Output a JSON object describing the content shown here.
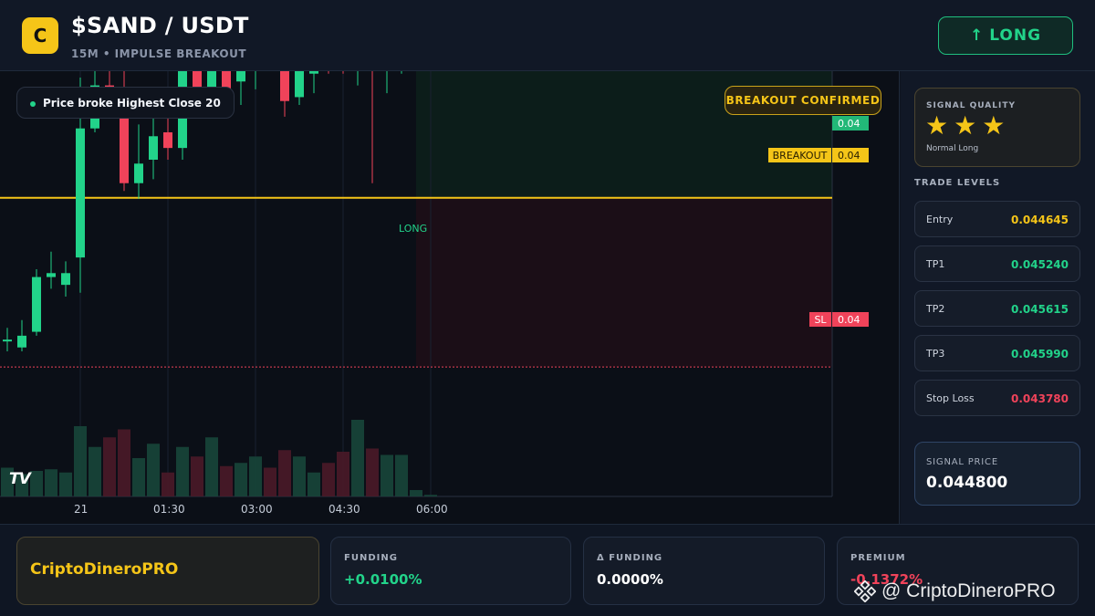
{
  "header": {
    "logo_letter": "C",
    "pair": "$SAND / USDT",
    "subtitle": "15M • IMPULSE BREAKOUT",
    "direction_arrow": "↑",
    "direction_label": "LONG",
    "accent": "#22d38a"
  },
  "chart": {
    "info_pill": "Price broke Highest Close 20",
    "confirmed_badge": "BREAKOUT CONFIRMED",
    "current_price_tag": "0.04",
    "breakout_label": "BREAKOUT",
    "breakout_value": "0.04",
    "sl_label": "SL",
    "sl_value": "0.04",
    "entry_marker_label": "LONG",
    "tv_logo": "TV",
    "x_ticks": [
      "21",
      "01:30",
      "03:00",
      "04:30",
      "06:00"
    ],
    "colors": {
      "up": "#22d38a",
      "down": "#f0435a",
      "breakout": "#f5c518"
    }
  },
  "chart_data": {
    "type": "candlestick",
    "y_axis_labels_shown": [
      "0.04"
    ],
    "price_scale": {
      "low": 0.04365,
      "high": 0.04505
    },
    "breakout_level": 0.044645,
    "stop_loss": 0.04378,
    "candles": [
      {
        "o": 0.04392,
        "h": 0.04398,
        "l": 0.04386,
        "c": 0.04392
      },
      {
        "o": 0.04388,
        "h": 0.04402,
        "l": 0.04386,
        "c": 0.04394
      },
      {
        "o": 0.04396,
        "h": 0.04428,
        "l": 0.04394,
        "c": 0.04424
      },
      {
        "o": 0.04424,
        "h": 0.04437,
        "l": 0.04418,
        "c": 0.04426
      },
      {
        "o": 0.0442,
        "h": 0.04432,
        "l": 0.04414,
        "c": 0.04426
      },
      {
        "o": 0.04434,
        "h": 0.04526,
        "l": 0.04416,
        "c": 0.045
      },
      {
        "o": 0.045,
        "h": 0.04542,
        "l": 0.04498,
        "c": 0.04522
      },
      {
        "o": 0.04522,
        "h": 0.0455,
        "l": 0.04514,
        "c": 0.04514
      },
      {
        "o": 0.04512,
        "h": 0.04556,
        "l": 0.04468,
        "c": 0.04472
      },
      {
        "o": 0.04472,
        "h": 0.04502,
        "l": 0.04464,
        "c": 0.04482
      },
      {
        "o": 0.04484,
        "h": 0.04516,
        "l": 0.04474,
        "c": 0.04496
      },
      {
        "o": 0.04498,
        "h": 0.04514,
        "l": 0.04484,
        "c": 0.0449
      },
      {
        "o": 0.0449,
        "h": 0.0455,
        "l": 0.04484,
        "c": 0.04536
      },
      {
        "o": 0.04534,
        "h": 0.0454,
        "l": 0.04514,
        "c": 0.04518
      },
      {
        "o": 0.04518,
        "h": 0.04542,
        "l": 0.04508,
        "c": 0.0454
      },
      {
        "o": 0.04538,
        "h": 0.04544,
        "l": 0.0452,
        "c": 0.0452
      },
      {
        "o": 0.04524,
        "h": 0.04536,
        "l": 0.04512,
        "c": 0.04532
      },
      {
        "o": 0.0453,
        "h": 0.0456,
        "l": 0.0452,
        "c": 0.0455
      },
      {
        "o": 0.04546,
        "h": 0.04556,
        "l": 0.04534,
        "c": 0.04536
      },
      {
        "o": 0.04542,
        "h": 0.04552,
        "l": 0.04506,
        "c": 0.04514
      },
      {
        "o": 0.04516,
        "h": 0.04546,
        "l": 0.04512,
        "c": 0.0453
      },
      {
        "o": 0.04528,
        "h": 0.04554,
        "l": 0.04518,
        "c": 0.04544
      },
      {
        "o": 0.04542,
        "h": 0.04546,
        "l": 0.04528,
        "c": 0.04538
      },
      {
        "o": 0.04538,
        "h": 0.0455,
        "l": 0.04528,
        "c": 0.04534
      },
      {
        "o": 0.04532,
        "h": 0.04544,
        "l": 0.04522,
        "c": 0.04544
      },
      {
        "o": 0.04544,
        "h": 0.0455,
        "l": 0.04472,
        "c": 0.04538
      },
      {
        "o": 0.0453,
        "h": 0.0454,
        "l": 0.04518,
        "c": 0.04534
      },
      {
        "o": 0.04534,
        "h": 0.04564,
        "l": 0.04528,
        "c": 0.0456
      },
      {
        "o": 0.0456,
        "h": 0.0461,
        "l": 0.04554,
        "c": 0.04602
      },
      {
        "o": 0.04602,
        "h": 0.04604,
        "l": 0.04602,
        "c": 0.04603
      }
    ],
    "volumes": [
      18,
      14,
      16,
      17,
      15,
      44,
      31,
      37,
      42,
      24,
      33,
      15,
      31,
      25,
      37,
      19,
      21,
      25,
      18,
      29,
      25,
      15,
      21,
      28,
      48,
      30,
      26,
      26,
      4,
      1
    ]
  },
  "panel": {
    "quality_title": "SIGNAL QUALITY",
    "stars": [
      "★",
      "★",
      "★"
    ],
    "quality_sub": "Normal Long",
    "levels_title": "TRADE LEVELS",
    "levels": [
      {
        "label": "Entry",
        "value": "0.044645",
        "color": "#f5c518"
      },
      {
        "label": "TP1",
        "value": "0.045240",
        "color": "#22d38a"
      },
      {
        "label": "TP2",
        "value": "0.045615",
        "color": "#22d38a"
      },
      {
        "label": "TP3",
        "value": "0.045990",
        "color": "#22d38a"
      },
      {
        "label": "Stop Loss",
        "value": "0.043780",
        "color": "#f0435a"
      }
    ],
    "signal_title": "SIGNAL PRICE",
    "signal_value": "0.044800"
  },
  "footer": {
    "brand": "CriptoDineroPRO",
    "stats": [
      {
        "title": "FUNDING",
        "value": "+0.0100%",
        "color": "#22d38a"
      },
      {
        "title": "Δ FUNDING",
        "value": "0.0000%",
        "color": "#ffffff"
      },
      {
        "title": "PREMIUM",
        "value": "-0.1372%",
        "color": "#f0435a"
      }
    ],
    "watermark": "@ CriptoDineroPRO"
  }
}
